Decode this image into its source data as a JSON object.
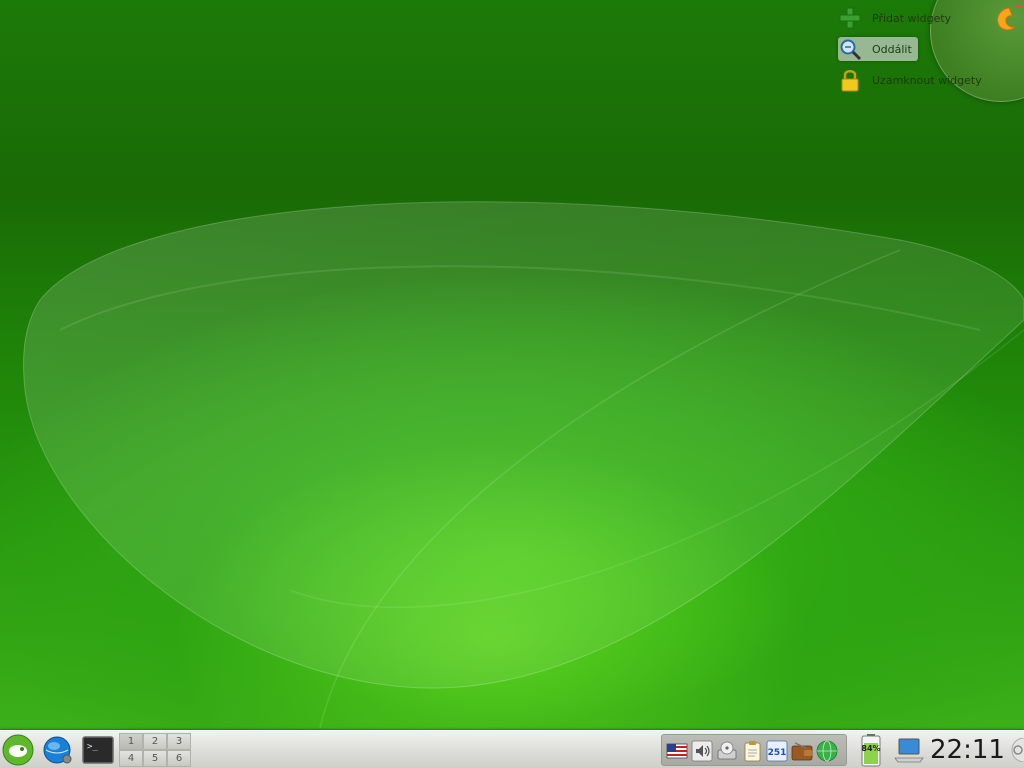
{
  "desktop": {
    "toolbox": {
      "add_widgets": "Přidat widgety",
      "zoom_out": "Oddálit",
      "lock_widgets": "Uzamknout widgety"
    }
  },
  "panel": {
    "pager": [
      "1",
      "2",
      "3",
      "4",
      "5",
      "6"
    ],
    "battery_percent": "84%",
    "clock": "22:11",
    "tray_count": "251"
  },
  "colors": {
    "panel": "#dcdcd8",
    "wallpaper_green": "#2ea512"
  }
}
